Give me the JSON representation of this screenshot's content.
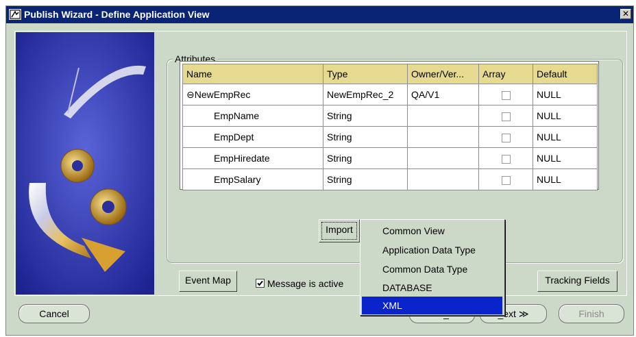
{
  "window": {
    "title": "Publish Wizard - Define Application View",
    "close_label": "✕"
  },
  "attributes": {
    "legend": "Attributes",
    "columns": [
      "Name",
      "Type",
      "Owner/Ver...",
      "Array",
      "Default"
    ],
    "rows": [
      {
        "expander": "⊖",
        "name": "NewEmpRec",
        "type": "NewEmpRec_2",
        "owner": "QA/V1",
        "array": false,
        "default": "NULL"
      },
      {
        "name": "EmpName",
        "type": "String",
        "owner": "",
        "array": false,
        "default": "NULL"
      },
      {
        "name": "EmpDept",
        "type": "String",
        "owner": "",
        "array": false,
        "default": "NULL"
      },
      {
        "name": "EmpHiredate",
        "type": "String",
        "owner": "",
        "array": false,
        "default": "NULL"
      },
      {
        "name": "EmpSalary",
        "type": "String",
        "owner": "",
        "array": false,
        "default": "NULL"
      }
    ]
  },
  "buttons": {
    "import": "Import",
    "event_map": "Event Map",
    "tracking_fields": "Tracking Fields",
    "cancel": "Cancel",
    "back": "< _",
    "next": "_ext ≫",
    "finish": "Finish"
  },
  "message_active": {
    "label": "Message is active",
    "checked": true
  },
  "import_menu": {
    "items": [
      "Common View",
      "Application Data Type",
      "Common Data Type",
      "DATABASE",
      "XML"
    ],
    "selected_index": 4
  },
  "colors": {
    "title_bar": "#0a2475",
    "panel": "#ccd9c8",
    "table_header": "#e5da8f",
    "menu_selected": "#0a24cc"
  }
}
